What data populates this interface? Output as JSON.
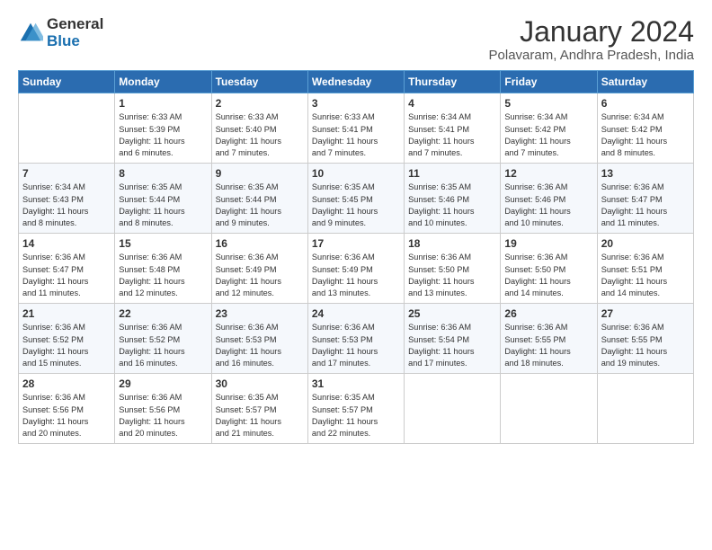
{
  "logo": {
    "general": "General",
    "blue": "Blue"
  },
  "title": "January 2024",
  "location": "Polavaram, Andhra Pradesh, India",
  "days_header": [
    "Sunday",
    "Monday",
    "Tuesday",
    "Wednesday",
    "Thursday",
    "Friday",
    "Saturday"
  ],
  "weeks": [
    [
      {
        "day": "",
        "content": ""
      },
      {
        "day": "1",
        "content": "Sunrise: 6:33 AM\nSunset: 5:39 PM\nDaylight: 11 hours\nand 6 minutes."
      },
      {
        "day": "2",
        "content": "Sunrise: 6:33 AM\nSunset: 5:40 PM\nDaylight: 11 hours\nand 7 minutes."
      },
      {
        "day": "3",
        "content": "Sunrise: 6:33 AM\nSunset: 5:41 PM\nDaylight: 11 hours\nand 7 minutes."
      },
      {
        "day": "4",
        "content": "Sunrise: 6:34 AM\nSunset: 5:41 PM\nDaylight: 11 hours\nand 7 minutes."
      },
      {
        "day": "5",
        "content": "Sunrise: 6:34 AM\nSunset: 5:42 PM\nDaylight: 11 hours\nand 7 minutes."
      },
      {
        "day": "6",
        "content": "Sunrise: 6:34 AM\nSunset: 5:42 PM\nDaylight: 11 hours\nand 8 minutes."
      }
    ],
    [
      {
        "day": "7",
        "content": "Sunrise: 6:34 AM\nSunset: 5:43 PM\nDaylight: 11 hours\nand 8 minutes."
      },
      {
        "day": "8",
        "content": "Sunrise: 6:35 AM\nSunset: 5:44 PM\nDaylight: 11 hours\nand 8 minutes."
      },
      {
        "day": "9",
        "content": "Sunrise: 6:35 AM\nSunset: 5:44 PM\nDaylight: 11 hours\nand 9 minutes."
      },
      {
        "day": "10",
        "content": "Sunrise: 6:35 AM\nSunset: 5:45 PM\nDaylight: 11 hours\nand 9 minutes."
      },
      {
        "day": "11",
        "content": "Sunrise: 6:35 AM\nSunset: 5:46 PM\nDaylight: 11 hours\nand 10 minutes."
      },
      {
        "day": "12",
        "content": "Sunrise: 6:36 AM\nSunset: 5:46 PM\nDaylight: 11 hours\nand 10 minutes."
      },
      {
        "day": "13",
        "content": "Sunrise: 6:36 AM\nSunset: 5:47 PM\nDaylight: 11 hours\nand 11 minutes."
      }
    ],
    [
      {
        "day": "14",
        "content": "Sunrise: 6:36 AM\nSunset: 5:47 PM\nDaylight: 11 hours\nand 11 minutes."
      },
      {
        "day": "15",
        "content": "Sunrise: 6:36 AM\nSunset: 5:48 PM\nDaylight: 11 hours\nand 12 minutes."
      },
      {
        "day": "16",
        "content": "Sunrise: 6:36 AM\nSunset: 5:49 PM\nDaylight: 11 hours\nand 12 minutes."
      },
      {
        "day": "17",
        "content": "Sunrise: 6:36 AM\nSunset: 5:49 PM\nDaylight: 11 hours\nand 13 minutes."
      },
      {
        "day": "18",
        "content": "Sunrise: 6:36 AM\nSunset: 5:50 PM\nDaylight: 11 hours\nand 13 minutes."
      },
      {
        "day": "19",
        "content": "Sunrise: 6:36 AM\nSunset: 5:50 PM\nDaylight: 11 hours\nand 14 minutes."
      },
      {
        "day": "20",
        "content": "Sunrise: 6:36 AM\nSunset: 5:51 PM\nDaylight: 11 hours\nand 14 minutes."
      }
    ],
    [
      {
        "day": "21",
        "content": "Sunrise: 6:36 AM\nSunset: 5:52 PM\nDaylight: 11 hours\nand 15 minutes."
      },
      {
        "day": "22",
        "content": "Sunrise: 6:36 AM\nSunset: 5:52 PM\nDaylight: 11 hours\nand 16 minutes."
      },
      {
        "day": "23",
        "content": "Sunrise: 6:36 AM\nSunset: 5:53 PM\nDaylight: 11 hours\nand 16 minutes."
      },
      {
        "day": "24",
        "content": "Sunrise: 6:36 AM\nSunset: 5:53 PM\nDaylight: 11 hours\nand 17 minutes."
      },
      {
        "day": "25",
        "content": "Sunrise: 6:36 AM\nSunset: 5:54 PM\nDaylight: 11 hours\nand 17 minutes."
      },
      {
        "day": "26",
        "content": "Sunrise: 6:36 AM\nSunset: 5:55 PM\nDaylight: 11 hours\nand 18 minutes."
      },
      {
        "day": "27",
        "content": "Sunrise: 6:36 AM\nSunset: 5:55 PM\nDaylight: 11 hours\nand 19 minutes."
      }
    ],
    [
      {
        "day": "28",
        "content": "Sunrise: 6:36 AM\nSunset: 5:56 PM\nDaylight: 11 hours\nand 20 minutes."
      },
      {
        "day": "29",
        "content": "Sunrise: 6:36 AM\nSunset: 5:56 PM\nDaylight: 11 hours\nand 20 minutes."
      },
      {
        "day": "30",
        "content": "Sunrise: 6:35 AM\nSunset: 5:57 PM\nDaylight: 11 hours\nand 21 minutes."
      },
      {
        "day": "31",
        "content": "Sunrise: 6:35 AM\nSunset: 5:57 PM\nDaylight: 11 hours\nand 22 minutes."
      },
      {
        "day": "",
        "content": ""
      },
      {
        "day": "",
        "content": ""
      },
      {
        "day": "",
        "content": ""
      }
    ]
  ]
}
